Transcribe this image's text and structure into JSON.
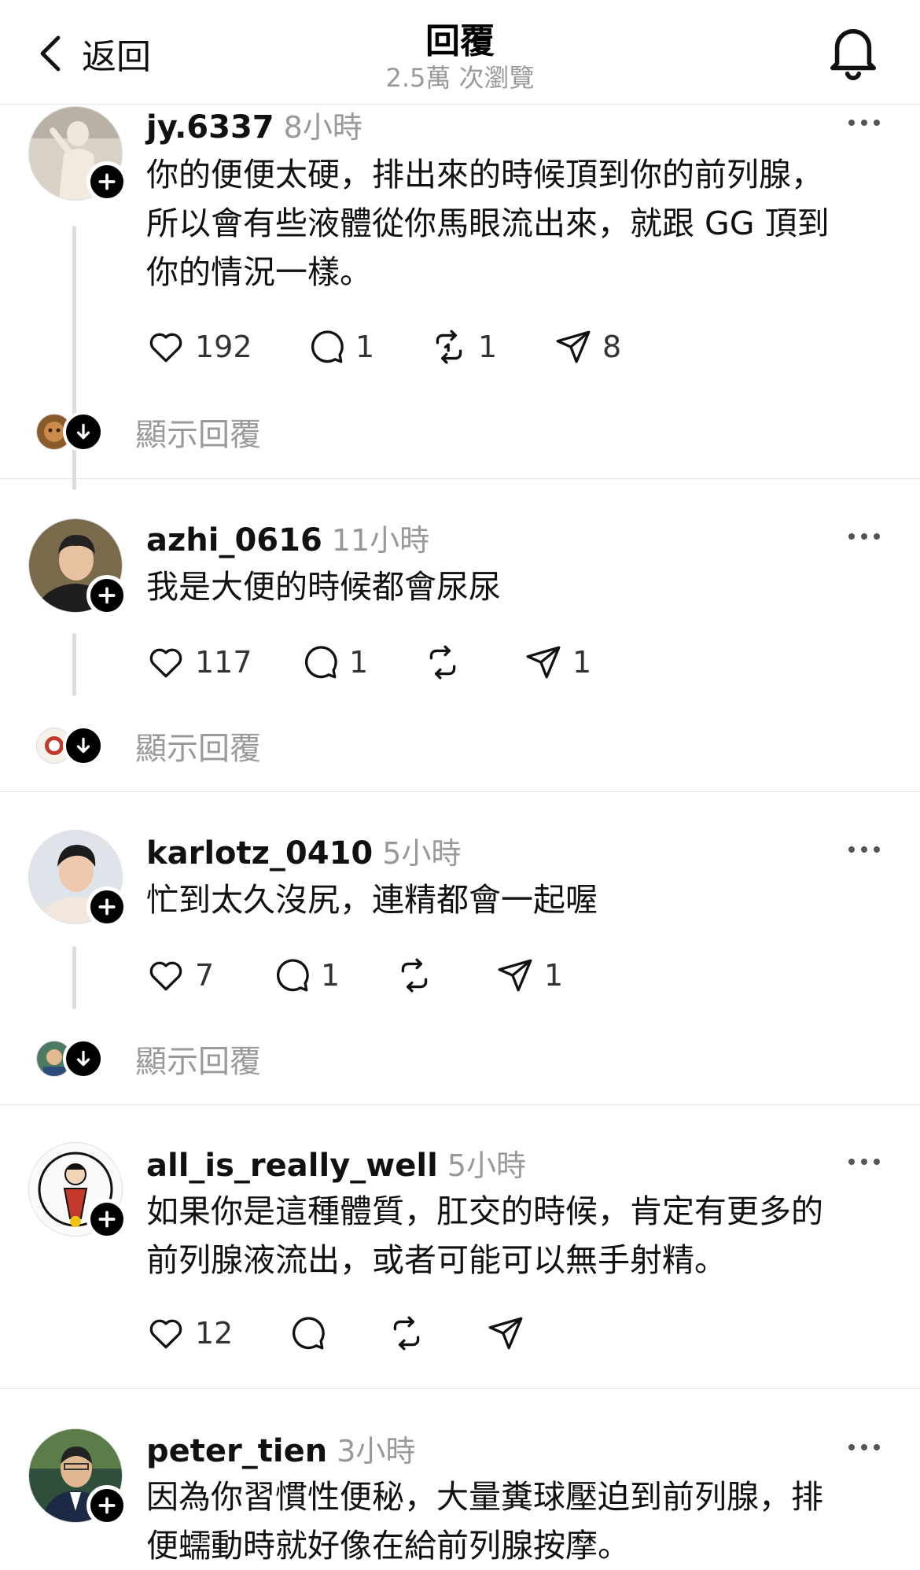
{
  "header": {
    "back_label": "返回",
    "title": "回覆",
    "views": "2.5萬 次瀏覽"
  },
  "threads": [
    {
      "username": "jy.6337",
      "time": "8小時",
      "text_lines": [
        "你的便便太硬，排出來的時候頂到你的前列腺，",
        "所以會有些液體從你馬眼流出來，就跟 GG 頂到",
        "你的情況一樣。"
      ],
      "likes": "192",
      "comments": "1",
      "reposts": "1",
      "shares": "8",
      "show_replies": "顯示回覆"
    },
    {
      "username": "azhi_0616",
      "time": "11小時",
      "text_lines": [
        "我是大便的時候都會尿尿"
      ],
      "likes": "117",
      "comments": "1",
      "reposts": "",
      "shares": "1",
      "show_replies": "顯示回覆"
    },
    {
      "username": "karlotz_0410",
      "time": "5小時",
      "text_lines": [
        "忙到太久沒尻，連精都會一起喔"
      ],
      "likes": "7",
      "comments": "1",
      "reposts": "",
      "shares": "1",
      "show_replies": "顯示回覆"
    },
    {
      "username": "all_is_really_well",
      "time": "5小時",
      "text_lines": [
        "如果你是這種體質，肛交的時候，肯定有更多的",
        "前列腺液流出，或者可能可以無手射精。"
      ],
      "likes": "12",
      "comments": "",
      "reposts": "",
      "shares": ""
    },
    {
      "username": "peter_tien",
      "time": "3小時",
      "text_lines": [
        "因為你習慣性便秘，大量糞球壓迫到前列腺，排",
        "便蠕動時就好像在給前列腺按摩。"
      ]
    }
  ],
  "icons": [
    "chevron-left-icon",
    "bell-icon",
    "plus-icon",
    "more-icon",
    "heart-icon",
    "comment-icon",
    "repost-icon",
    "share-icon",
    "arrow-down-icon"
  ],
  "colors": {
    "text": "#111111",
    "muted": "#999999",
    "divider": "#e3e3e3",
    "thread_line": "#dcdcdc"
  }
}
